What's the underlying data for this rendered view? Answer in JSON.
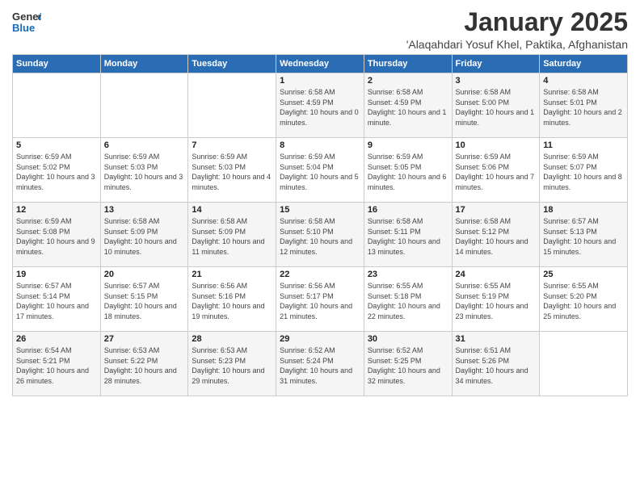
{
  "logo": {
    "general": "General",
    "blue": "Blue"
  },
  "title": "January 2025",
  "location": "'Alaqahdari Yosuf Khel, Paktika, Afghanistan",
  "headers": [
    "Sunday",
    "Monday",
    "Tuesday",
    "Wednesday",
    "Thursday",
    "Friday",
    "Saturday"
  ],
  "weeks": [
    [
      {
        "day": "",
        "sunrise": "",
        "sunset": "",
        "daylight": ""
      },
      {
        "day": "",
        "sunrise": "",
        "sunset": "",
        "daylight": ""
      },
      {
        "day": "",
        "sunrise": "",
        "sunset": "",
        "daylight": ""
      },
      {
        "day": "1",
        "sunrise": "Sunrise: 6:58 AM",
        "sunset": "Sunset: 4:59 PM",
        "daylight": "Daylight: 10 hours and 0 minutes."
      },
      {
        "day": "2",
        "sunrise": "Sunrise: 6:58 AM",
        "sunset": "Sunset: 4:59 PM",
        "daylight": "Daylight: 10 hours and 1 minute."
      },
      {
        "day": "3",
        "sunrise": "Sunrise: 6:58 AM",
        "sunset": "Sunset: 5:00 PM",
        "daylight": "Daylight: 10 hours and 1 minute."
      },
      {
        "day": "4",
        "sunrise": "Sunrise: 6:58 AM",
        "sunset": "Sunset: 5:01 PM",
        "daylight": "Daylight: 10 hours and 2 minutes."
      }
    ],
    [
      {
        "day": "5",
        "sunrise": "Sunrise: 6:59 AM",
        "sunset": "Sunset: 5:02 PM",
        "daylight": "Daylight: 10 hours and 3 minutes."
      },
      {
        "day": "6",
        "sunrise": "Sunrise: 6:59 AM",
        "sunset": "Sunset: 5:03 PM",
        "daylight": "Daylight: 10 hours and 3 minutes."
      },
      {
        "day": "7",
        "sunrise": "Sunrise: 6:59 AM",
        "sunset": "Sunset: 5:03 PM",
        "daylight": "Daylight: 10 hours and 4 minutes."
      },
      {
        "day": "8",
        "sunrise": "Sunrise: 6:59 AM",
        "sunset": "Sunset: 5:04 PM",
        "daylight": "Daylight: 10 hours and 5 minutes."
      },
      {
        "day": "9",
        "sunrise": "Sunrise: 6:59 AM",
        "sunset": "Sunset: 5:05 PM",
        "daylight": "Daylight: 10 hours and 6 minutes."
      },
      {
        "day": "10",
        "sunrise": "Sunrise: 6:59 AM",
        "sunset": "Sunset: 5:06 PM",
        "daylight": "Daylight: 10 hours and 7 minutes."
      },
      {
        "day": "11",
        "sunrise": "Sunrise: 6:59 AM",
        "sunset": "Sunset: 5:07 PM",
        "daylight": "Daylight: 10 hours and 8 minutes."
      }
    ],
    [
      {
        "day": "12",
        "sunrise": "Sunrise: 6:59 AM",
        "sunset": "Sunset: 5:08 PM",
        "daylight": "Daylight: 10 hours and 9 minutes."
      },
      {
        "day": "13",
        "sunrise": "Sunrise: 6:58 AM",
        "sunset": "Sunset: 5:09 PM",
        "daylight": "Daylight: 10 hours and 10 minutes."
      },
      {
        "day": "14",
        "sunrise": "Sunrise: 6:58 AM",
        "sunset": "Sunset: 5:09 PM",
        "daylight": "Daylight: 10 hours and 11 minutes."
      },
      {
        "day": "15",
        "sunrise": "Sunrise: 6:58 AM",
        "sunset": "Sunset: 5:10 PM",
        "daylight": "Daylight: 10 hours and 12 minutes."
      },
      {
        "day": "16",
        "sunrise": "Sunrise: 6:58 AM",
        "sunset": "Sunset: 5:11 PM",
        "daylight": "Daylight: 10 hours and 13 minutes."
      },
      {
        "day": "17",
        "sunrise": "Sunrise: 6:58 AM",
        "sunset": "Sunset: 5:12 PM",
        "daylight": "Daylight: 10 hours and 14 minutes."
      },
      {
        "day": "18",
        "sunrise": "Sunrise: 6:57 AM",
        "sunset": "Sunset: 5:13 PM",
        "daylight": "Daylight: 10 hours and 15 minutes."
      }
    ],
    [
      {
        "day": "19",
        "sunrise": "Sunrise: 6:57 AM",
        "sunset": "Sunset: 5:14 PM",
        "daylight": "Daylight: 10 hours and 17 minutes."
      },
      {
        "day": "20",
        "sunrise": "Sunrise: 6:57 AM",
        "sunset": "Sunset: 5:15 PM",
        "daylight": "Daylight: 10 hours and 18 minutes."
      },
      {
        "day": "21",
        "sunrise": "Sunrise: 6:56 AM",
        "sunset": "Sunset: 5:16 PM",
        "daylight": "Daylight: 10 hours and 19 minutes."
      },
      {
        "day": "22",
        "sunrise": "Sunrise: 6:56 AM",
        "sunset": "Sunset: 5:17 PM",
        "daylight": "Daylight: 10 hours and 21 minutes."
      },
      {
        "day": "23",
        "sunrise": "Sunrise: 6:55 AM",
        "sunset": "Sunset: 5:18 PM",
        "daylight": "Daylight: 10 hours and 22 minutes."
      },
      {
        "day": "24",
        "sunrise": "Sunrise: 6:55 AM",
        "sunset": "Sunset: 5:19 PM",
        "daylight": "Daylight: 10 hours and 23 minutes."
      },
      {
        "day": "25",
        "sunrise": "Sunrise: 6:55 AM",
        "sunset": "Sunset: 5:20 PM",
        "daylight": "Daylight: 10 hours and 25 minutes."
      }
    ],
    [
      {
        "day": "26",
        "sunrise": "Sunrise: 6:54 AM",
        "sunset": "Sunset: 5:21 PM",
        "daylight": "Daylight: 10 hours and 26 minutes."
      },
      {
        "day": "27",
        "sunrise": "Sunrise: 6:53 AM",
        "sunset": "Sunset: 5:22 PM",
        "daylight": "Daylight: 10 hours and 28 minutes."
      },
      {
        "day": "28",
        "sunrise": "Sunrise: 6:53 AM",
        "sunset": "Sunset: 5:23 PM",
        "daylight": "Daylight: 10 hours and 29 minutes."
      },
      {
        "day": "29",
        "sunrise": "Sunrise: 6:52 AM",
        "sunset": "Sunset: 5:24 PM",
        "daylight": "Daylight: 10 hours and 31 minutes."
      },
      {
        "day": "30",
        "sunrise": "Sunrise: 6:52 AM",
        "sunset": "Sunset: 5:25 PM",
        "daylight": "Daylight: 10 hours and 32 minutes."
      },
      {
        "day": "31",
        "sunrise": "Sunrise: 6:51 AM",
        "sunset": "Sunset: 5:26 PM",
        "daylight": "Daylight: 10 hours and 34 minutes."
      },
      {
        "day": "",
        "sunrise": "",
        "sunset": "",
        "daylight": ""
      }
    ]
  ]
}
